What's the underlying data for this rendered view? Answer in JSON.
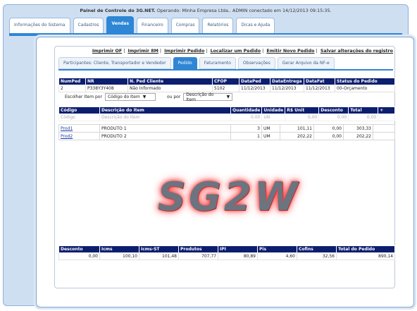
{
  "app": {
    "title_prefix": "Painel de Controle do 3G.NET.",
    "title_suffix": "Operando: Minha Empresa Ltda.. ADMIN conectado em 14/12/2013 09:15:35."
  },
  "top_tabs": [
    {
      "label": "Informações do Sistema",
      "active": false
    },
    {
      "label": "Cadastros",
      "active": false
    },
    {
      "label": "Vendas",
      "active": true
    },
    {
      "label": "Financeiro",
      "active": false
    },
    {
      "label": "Compras",
      "active": false
    },
    {
      "label": "Relatórios",
      "active": false
    },
    {
      "label": "Dicas e Ajuda",
      "active": false
    }
  ],
  "links": [
    "Imprimir OF",
    "Imprimir 8M",
    "Imprimir Pedido",
    "Localizar um Pedido",
    "Emitir Novo Pedido",
    "Salvar alterações do registro"
  ],
  "sub_tabs": [
    {
      "label": "Participantes: Cliente, Transportador e Vendedor",
      "active": false
    },
    {
      "label": "Pedido",
      "active": true
    },
    {
      "label": "Faturamento",
      "active": false
    },
    {
      "label": "Observações",
      "active": false
    },
    {
      "label": "Gerar Arquivo da NF-e",
      "active": false
    }
  ],
  "order_header": {
    "columns": [
      "NumPed",
      "NR",
      "N. Ped Cliente",
      "CFOP",
      "DataPed",
      "DataEntrega",
      "DataFat",
      "Status do Pedido"
    ],
    "row": [
      "2",
      "P338Y3Y408",
      "Não Informado",
      "5102",
      "11/12/2013",
      "11/12/2013",
      "11/12/2013",
      "00-Orçamento"
    ]
  },
  "search": {
    "label1": "Escolher Item por",
    "select1": "Código do Item",
    "label2": "ou por",
    "select2": "Descrição do Item"
  },
  "items": {
    "columns": [
      "Código",
      "Descrição do Item",
      "Quantidade",
      "Unidade",
      "R$ Unit",
      "Desconto",
      "Total",
      "+"
    ],
    "placeholder_row": [
      "Código",
      "Descrição do Item",
      "0,00",
      "UN",
      "0,00",
      "0,00",
      "0,00",
      "-"
    ],
    "rows": [
      [
        "Prod1",
        "PRODUTO 1",
        "3",
        "UM",
        "101,11",
        "0,00",
        "303,33"
      ],
      [
        "Prod2",
        "PRODUTO 2",
        "1",
        "UM",
        "202,22",
        "0,00",
        "202,22"
      ]
    ]
  },
  "watermark": "SG2W",
  "totals": {
    "columns": [
      "Desconto",
      "Icms",
      "Icms-ST",
      "Produtos",
      "IPI",
      "Pis",
      "Cofins",
      "Total do Pedido"
    ],
    "values": [
      "0,00",
      "100,10",
      "101,48",
      "707,77",
      "80,89",
      "4,60",
      "32,56",
      "890,14"
    ]
  }
}
